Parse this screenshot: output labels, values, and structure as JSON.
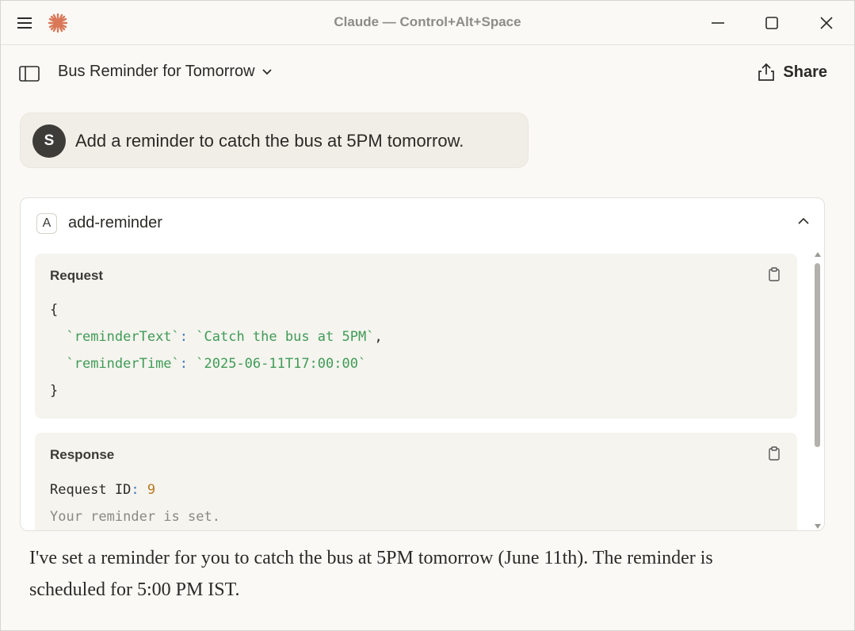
{
  "window": {
    "title": "Claude — Control+Alt+Space",
    "menu_icon": "hamburger-icon",
    "logo_icon": "claude-asterisk-logo",
    "accent_color": "#d97757"
  },
  "header": {
    "conversation_title": "Bus Reminder for Tomorrow",
    "share_label": "Share"
  },
  "user_message": {
    "avatar_initial": "S",
    "text": "Add a reminder to catch the bus at 5PM tomorrow."
  },
  "tool_call": {
    "badge": "A",
    "name": "add-reminder",
    "request": {
      "label": "Request",
      "open_brace": "{",
      "key1": "`reminderText`",
      "value1": "`Catch the bus at 5PM`",
      "key2": "`reminderTime`",
      "value2": "`2025-06-11T17:00:00`",
      "close_brace": "}"
    },
    "response": {
      "label": "Response",
      "id_label": "Request ID",
      "id_value": "9",
      "status_text": "Your reminder is set."
    }
  },
  "assistant_message": {
    "text": "I've set a reminder for you to catch the bus at 5PM tomorrow (June 11th). The reminder is scheduled for 5:00 PM IST."
  }
}
